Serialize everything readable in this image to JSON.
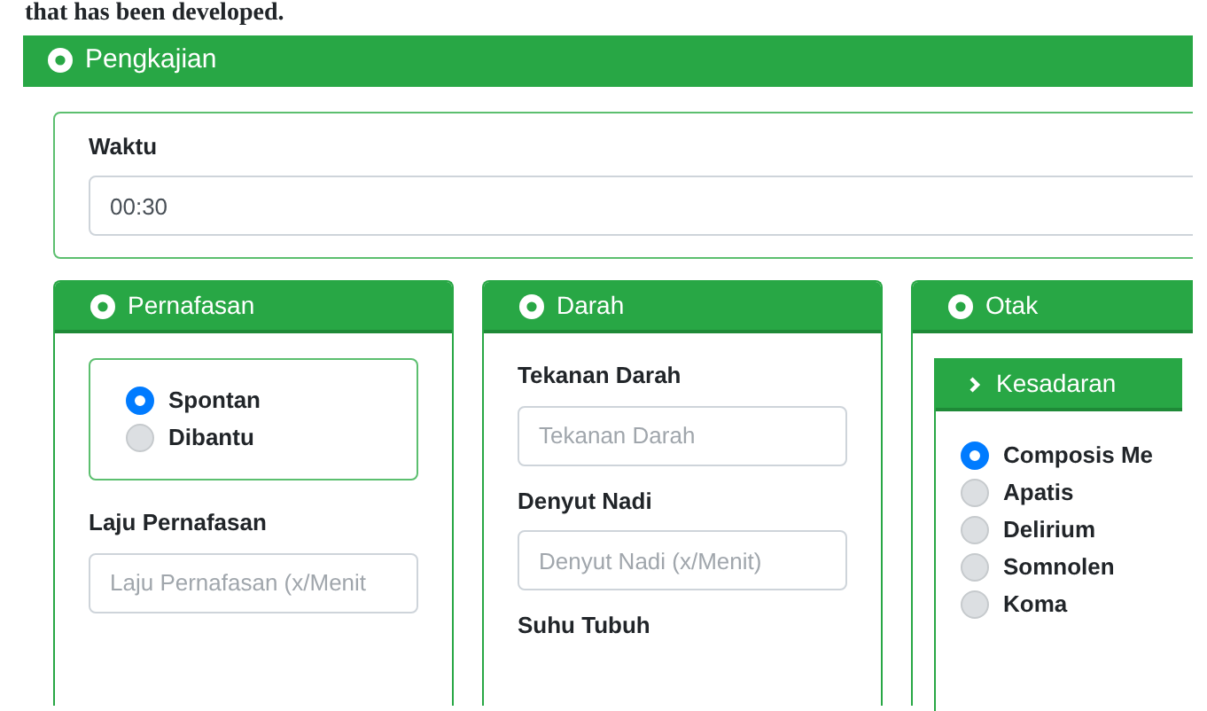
{
  "top_text": "that has been developed.",
  "section": {
    "title": "Pengkajian"
  },
  "time": {
    "label": "Waktu",
    "value": "00:30"
  },
  "cards": [
    {
      "title": "Pernafasan",
      "items": [
        {
          "kind": "radio-box",
          "options": [
            {
              "label": "Spontan",
              "selected": true
            },
            {
              "label": "Dibantu",
              "selected": false
            }
          ]
        },
        {
          "kind": "field",
          "label": "Laju Pernafasan",
          "placeholder": "Laju Pernafasan (x/Menit"
        }
      ]
    },
    {
      "title": "Darah",
      "items": [
        {
          "kind": "field",
          "label": "Tekanan Darah",
          "placeholder": "Tekanan Darah"
        },
        {
          "kind": "field",
          "label": "Denyut Nadi",
          "placeholder": "Denyut Nadi (x/Menit)"
        },
        {
          "kind": "label",
          "label": "Suhu Tubuh"
        }
      ]
    },
    {
      "title": "Otak",
      "items": [
        {
          "kind": "subcard",
          "title": "Kesadaran",
          "options": [
            {
              "label": "Composis Me",
              "selected": true
            },
            {
              "label": "Apatis",
              "selected": false
            },
            {
              "label": "Delirium",
              "selected": false
            },
            {
              "label": "Somnolen",
              "selected": false
            },
            {
              "label": "Koma",
              "selected": false
            }
          ]
        }
      ]
    }
  ]
}
